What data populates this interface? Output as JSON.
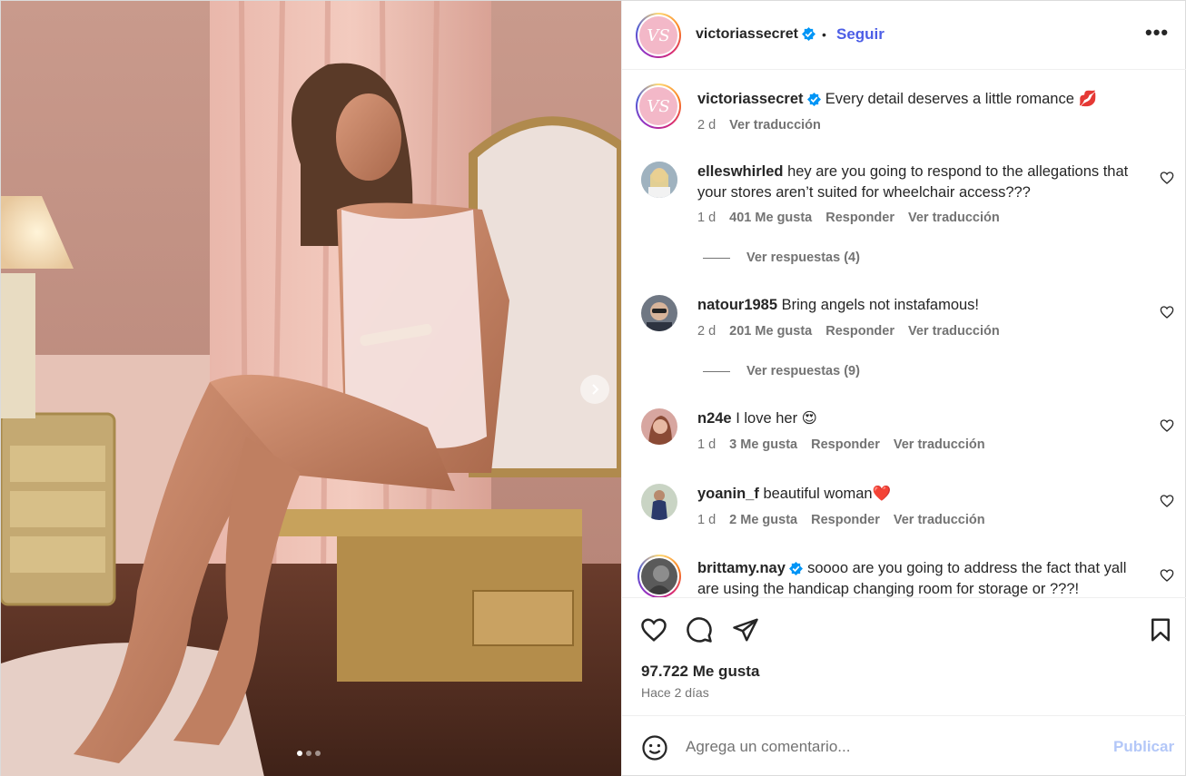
{
  "post": {
    "media_dots": 3,
    "active_dot": 0
  },
  "header": {
    "username": "victoriassecret",
    "separator": "•",
    "follow_label": "Seguir",
    "more_label": "•••",
    "logo_text": "VS"
  },
  "caption": {
    "username": "victoriassecret",
    "text": "Every detail deserves a little romance 💋",
    "time": "2 d",
    "translate": "Ver traducción"
  },
  "comments": [
    {
      "username": "elleswhirled",
      "text": "hey are you going to respond to the allegations that your stores aren’t suited for wheelchair access???",
      "time": "1 d",
      "likes": "401 Me gusta",
      "reply": "Responder",
      "translate": "Ver traducción",
      "replies": "Ver respuestas (4)"
    },
    {
      "username": "natour1985",
      "text": "Bring angels not instafamous!",
      "time": "2 d",
      "likes": "201 Me gusta",
      "reply": "Responder",
      "translate": "Ver traducción",
      "replies": "Ver respuestas (9)"
    },
    {
      "username": "n24e",
      "text": "I love her 😍",
      "time": "1 d",
      "likes": "3 Me gusta",
      "reply": "Responder",
      "translate": "Ver traducción"
    },
    {
      "username": "yoanin_f",
      "text": "beautiful woman❤️",
      "time": "1 d",
      "likes": "2 Me gusta",
      "reply": "Responder",
      "translate": "Ver traducción"
    },
    {
      "username": "brittamy.nay",
      "text": "soooo are you going to address the fact that yall are using the handicap changing room for storage or ???!"
    }
  ],
  "actions": {
    "likes_count": "97.722 Me gusta",
    "posted_ago": "Hace 2 días"
  },
  "composer": {
    "placeholder": "Agrega un comentario...",
    "publish_label": "Publicar"
  },
  "colors": {
    "link_blue": "#4c5ee6",
    "publish_disabled": "#b3c7f8",
    "verified": "#0095f6",
    "secondary_text": "#737373"
  },
  "icons": {
    "like": "heart-icon",
    "comment": "comment-icon",
    "share": "send-icon",
    "save": "bookmark-icon",
    "emoji": "emoji-icon",
    "more": "more-options-icon",
    "next": "chevron-right-icon"
  }
}
